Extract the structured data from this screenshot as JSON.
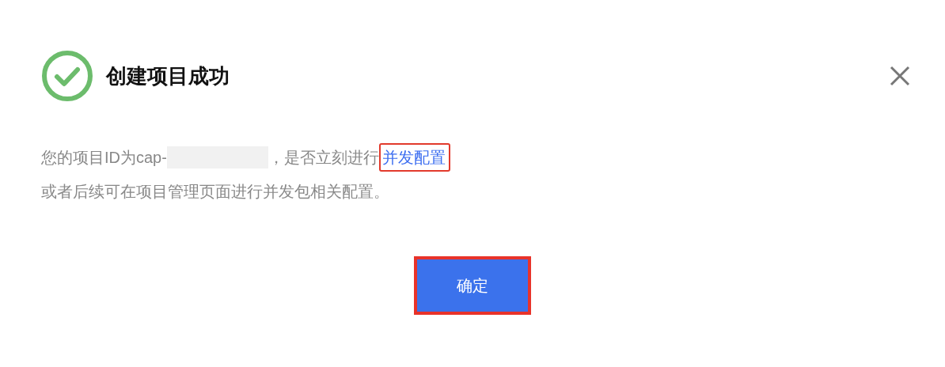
{
  "dialog": {
    "kind": "success",
    "title": "创建项目成功",
    "message": {
      "prefix": "您的项目ID为cap-",
      "redacted": true,
      "suffix": "，是否立刻进行",
      "link": {
        "label": "并发配置",
        "highlighted": true
      },
      "second_line": "或者后续可在项目管理页面进行并发包相关配置。"
    },
    "buttons": [
      {
        "label": "确定",
        "highlighted": true
      }
    ]
  }
}
